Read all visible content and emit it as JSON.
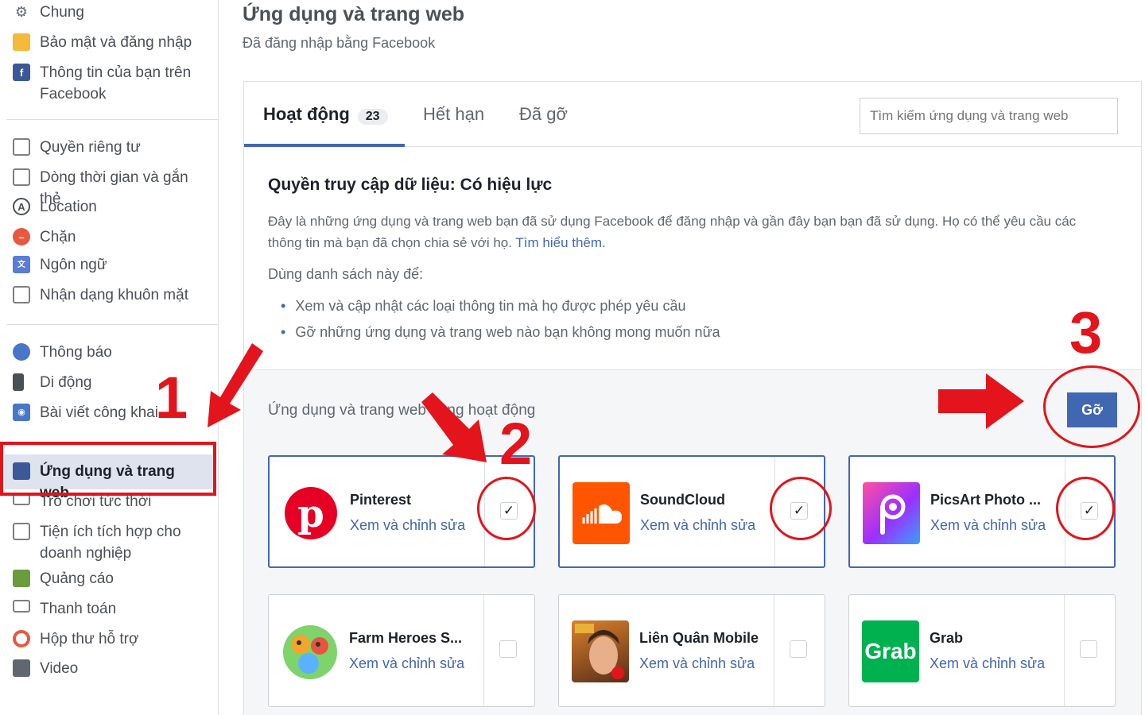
{
  "sidebar": {
    "items": [
      {
        "label": "Chung",
        "icon": "gear-icon"
      },
      {
        "label": "Bảo mật và đăng nhập",
        "icon": "lock-icon"
      },
      {
        "label": "Thông tin của bạn trên Facebook",
        "icon": "facebook-icon"
      },
      {
        "label": "Quyền riêng tư",
        "icon": "privacy-lock-icon"
      },
      {
        "label": "Dòng thời gian và gắn thẻ",
        "icon": "timeline-icon"
      },
      {
        "label": "Location",
        "icon": "location-icon"
      },
      {
        "label": "Chặn",
        "icon": "block-icon"
      },
      {
        "label": "Ngôn ngữ",
        "icon": "language-icon"
      },
      {
        "label": "Nhận dạng khuôn mặt",
        "icon": "face-recognition-icon"
      },
      {
        "label": "Thông báo",
        "icon": "globe-icon"
      },
      {
        "label": "Di động",
        "icon": "mobile-icon"
      },
      {
        "label": "Bài viết công khai",
        "icon": "rss-icon"
      },
      {
        "label": "Ứng dụng và trang web",
        "icon": "apps-icon"
      },
      {
        "label": "Trò chơi tức thời",
        "icon": "game-icon"
      },
      {
        "label": "Tiện ích tích hợp cho doanh nghiệp",
        "icon": "business-integration-icon"
      },
      {
        "label": "Quảng cáo",
        "icon": "ads-icon"
      },
      {
        "label": "Thanh toán",
        "icon": "payment-icon"
      },
      {
        "label": "Hộp thư hỗ trợ",
        "icon": "support-icon"
      },
      {
        "label": "Video",
        "icon": "video-icon"
      }
    ]
  },
  "header": {
    "title": "Ứng dụng và trang web",
    "subtitle": "Đã đăng nhập bằng Facebook"
  },
  "tabs": [
    {
      "label": "Hoạt động",
      "count": "23"
    },
    {
      "label": "Hết hạn"
    },
    {
      "label": "Đã gỡ"
    }
  ],
  "search": {
    "placeholder": "Tìm kiếm ứng dụng và trang web"
  },
  "access": {
    "title": "Quyền truy cập dữ liệu: Có hiệu lực",
    "description": "Đây là những ứng dụng và trang web bạn đã sử dụng Facebook để đăng nhập và gần đây bạn bạn đã sử dụng. Họ có thể yêu cầu các thông tin mà bạn đã chọn chia sẻ với họ.",
    "learn_more": "Tìm hiểu thêm.",
    "use_list_title": "Dùng danh sách này để:",
    "bullets": [
      "Xem và cập nhật các loại thông tin mà họ được phép yêu cầu",
      "Gỡ những ứng dụng và trang web nào bạn không mong muốn nữa"
    ]
  },
  "apps": {
    "section_label": "Ứng dụng và trang web đang hoạt động",
    "remove_label": "Gỡ",
    "edit_label": "Xem và chỉnh sửa",
    "items": [
      {
        "name": "Pinterest",
        "checked": true,
        "color": "#e60023",
        "icon": "pinterest-icon"
      },
      {
        "name": "SoundCloud",
        "checked": true,
        "color": "#ff5500",
        "icon": "soundcloud-icon"
      },
      {
        "name": "PicsArt Photo ...",
        "checked": true,
        "color": "#c209c1",
        "icon": "picsart-icon"
      },
      {
        "name": "Farm Heroes S...",
        "checked": false,
        "color": "#39b54a",
        "icon": "farm-heroes-icon"
      },
      {
        "name": "Liên Quân Mobile",
        "checked": false,
        "color": "#8a4b2a",
        "icon": "lien-quan-icon"
      },
      {
        "name": "Grab",
        "checked": false,
        "color": "#00b14f",
        "icon": "grab-icon",
        "logo_text": "Grab"
      }
    ]
  },
  "annotations": {
    "step1": "1",
    "step2": "2",
    "step3": "3",
    "color": "#e3141b"
  }
}
